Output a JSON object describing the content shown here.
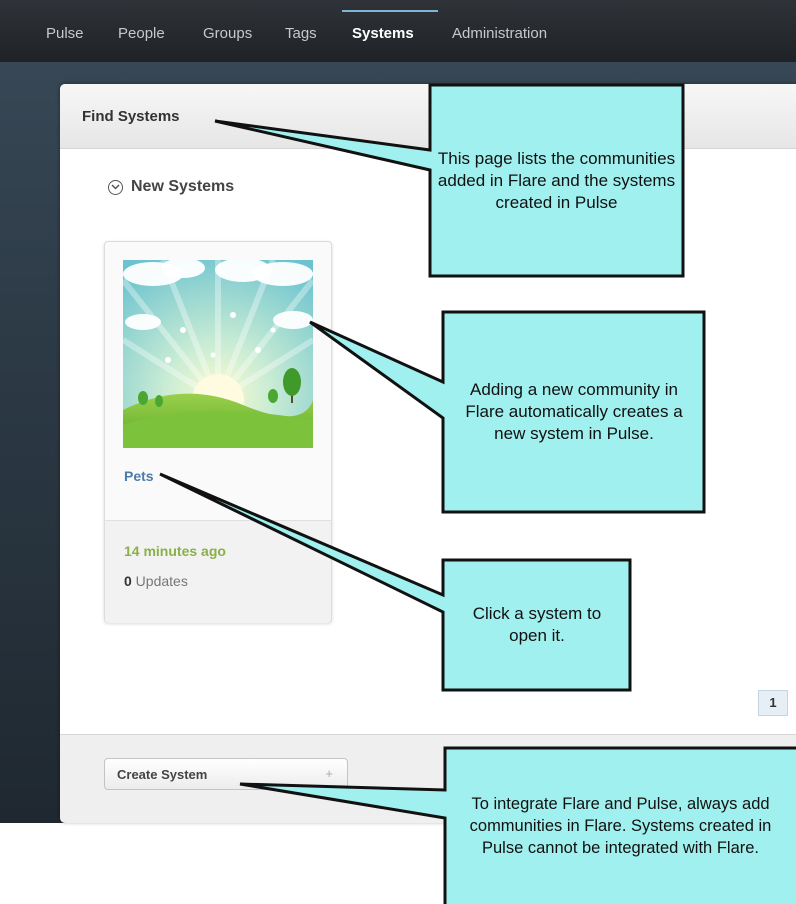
{
  "nav": {
    "items": [
      {
        "label": "Pulse",
        "active": false
      },
      {
        "label": "People",
        "active": false
      },
      {
        "label": "Groups",
        "active": false
      },
      {
        "label": "Tags",
        "active": false
      },
      {
        "label": "Systems",
        "active": true
      },
      {
        "label": "Administration",
        "active": false
      }
    ]
  },
  "panel": {
    "title": "Find Systems",
    "section_label": "New Systems"
  },
  "system_card": {
    "name": "Pets",
    "time": "14 minutes ago",
    "update_count": "0",
    "update_label": " Updates"
  },
  "pagination": {
    "current_page": "1"
  },
  "footer": {
    "create_button_label": "Create System",
    "create_button_plus": "+"
  },
  "callouts": [
    {
      "text": "This page lists the communities added in Flare and the systems created in Pulse"
    },
    {
      "text": "Adding a new community in Flare automatically creates a new system in Pulse."
    },
    {
      "text": "Click a system to open it."
    },
    {
      "text": "To integrate Flare and Pulse, always add communities in Flare. Systems created in Pulse cannot be integrated with Flare."
    }
  ],
  "colors": {
    "callout_fill": "#9ff0ee",
    "callout_stroke": "#111111",
    "link_blue": "#4a7cae",
    "time_green": "#8ab04a"
  }
}
